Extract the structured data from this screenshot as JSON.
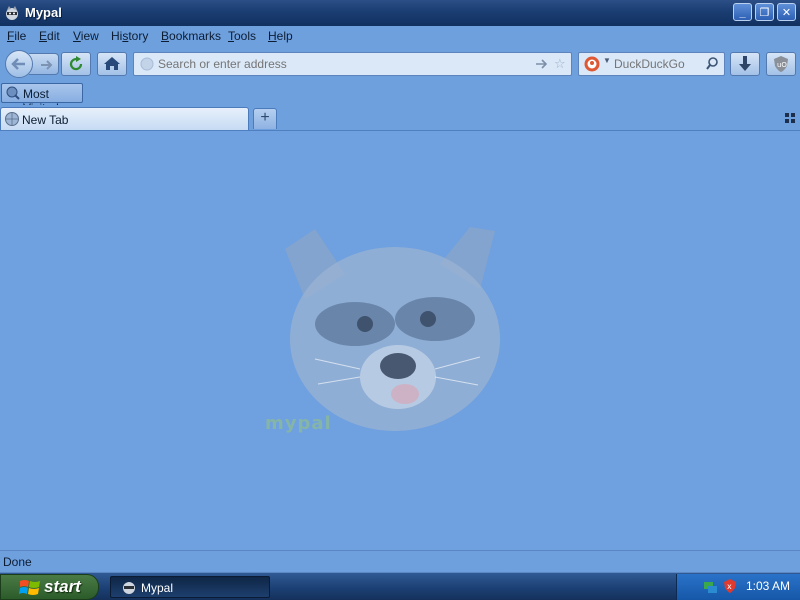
{
  "window": {
    "title": "Mypal",
    "controls": {
      "minimize": "_",
      "restore": "❐",
      "close": "✕"
    }
  },
  "menu": {
    "items": [
      {
        "label": "File",
        "accel": "F"
      },
      {
        "label": "Edit",
        "accel": "E"
      },
      {
        "label": "View",
        "accel": "V"
      },
      {
        "label": "History",
        "accel": "s"
      },
      {
        "label": "Bookmarks",
        "accel": "B"
      },
      {
        "label": "Tools",
        "accel": "T"
      },
      {
        "label": "Help",
        "accel": "H"
      }
    ]
  },
  "navbar": {
    "url_placeholder": "Search or enter address",
    "url_value": "",
    "search_engine": "DuckDuckGo",
    "search_placeholder": "DuckDuckGo",
    "icons": {
      "back": "back-arrow-icon",
      "forward": "forward-arrow-icon",
      "reload": "reload-icon",
      "home": "home-icon",
      "go": "go-arrow-icon",
      "bookmark_star": "star-icon",
      "search": "magnifier-icon",
      "downloads": "download-arrow-icon",
      "ublock": "shield-icon"
    }
  },
  "bookmarks": {
    "items": [
      {
        "label": "Most Visited"
      }
    ]
  },
  "tabs": {
    "items": [
      {
        "label": "New Tab",
        "active": true
      }
    ],
    "new_tab_symbol": "+"
  },
  "content": {
    "watermark": "mypal"
  },
  "status": {
    "text": "Done"
  },
  "taskbar": {
    "start_label": "start",
    "tasks": [
      {
        "label": "Mypal"
      }
    ],
    "clock": "1:03 AM"
  },
  "colors": {
    "titlebar": "#1a3d72",
    "chrome": "#6fa0de",
    "content_bg": "#6fa0e0",
    "taskbar": "#1d4277",
    "start_green": "#3a6a36"
  }
}
